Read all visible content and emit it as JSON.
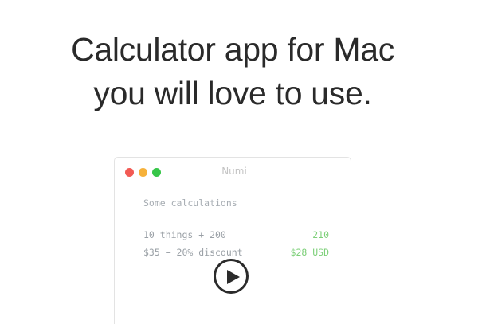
{
  "headline": {
    "line1": "Calculator app for Mac",
    "line2": "you will love to use."
  },
  "window": {
    "title": "Numi",
    "traffic_lights": [
      "close",
      "minimize",
      "zoom"
    ],
    "comment": "Some calculations",
    "rows": [
      {
        "expression": "10 things + 200",
        "result": "210"
      },
      {
        "expression": "$35 − 20% discount",
        "result": "$28 USD"
      }
    ]
  },
  "play_button": {
    "icon": "play-icon"
  },
  "colors": {
    "result": "#7ed07a",
    "traffic_red": "#f25a54",
    "traffic_yellow": "#f6b13a",
    "traffic_green": "#36c648"
  }
}
